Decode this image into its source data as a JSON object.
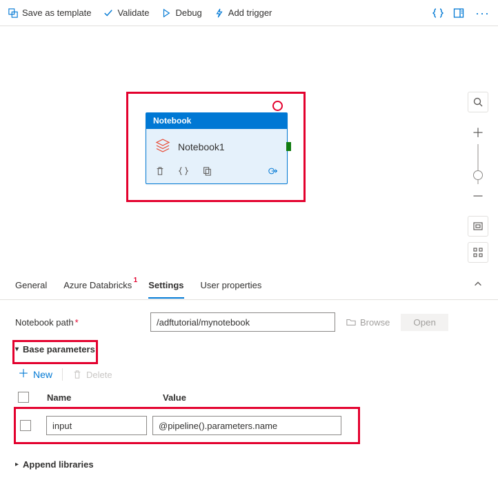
{
  "toolbar": {
    "save_template": "Save as template",
    "validate": "Validate",
    "debug": "Debug",
    "add_trigger": "Add trigger"
  },
  "canvas_node": {
    "type_label": "Notebook",
    "name": "Notebook1"
  },
  "tabs": {
    "general": "General",
    "azure_databricks": "Azure Databricks",
    "settings": "Settings",
    "user_properties": "User properties",
    "badge": "1"
  },
  "settings": {
    "notebook_path_label": "Notebook path",
    "notebook_path_value": "/adftutorial/mynotebook",
    "browse_label": "Browse",
    "open_label": "Open",
    "base_parameters_label": "Base parameters",
    "new_label": "New",
    "delete_label": "Delete",
    "col_name_label": "Name",
    "col_value_label": "Value",
    "param_name": "input",
    "param_value": "@pipeline().parameters.name",
    "append_libraries_label": "Append libraries"
  }
}
